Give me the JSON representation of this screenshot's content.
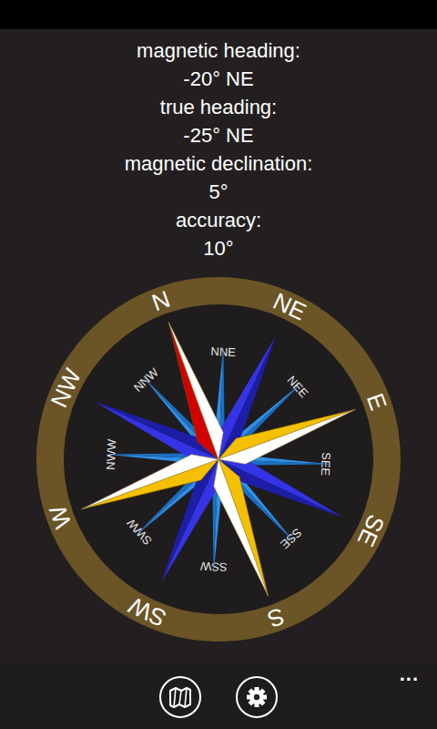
{
  "readouts": [
    {
      "label": "magnetic heading:",
      "value": "-20° NE"
    },
    {
      "label": "true heading:",
      "value": "-25° NE"
    },
    {
      "label": "magnetic declination:",
      "value": "5°"
    },
    {
      "label": "accuracy:",
      "value": "10°"
    }
  ],
  "compass": {
    "heading_degrees": -20,
    "cardinal_labels": [
      "N",
      "NE",
      "E",
      "SE",
      "S",
      "SW",
      "W",
      "NW"
    ],
    "minor_labels": [
      "NNE",
      "NEE",
      "SEE",
      "SSE",
      "SSW",
      "SWW",
      "NWW",
      "NNW"
    ]
  },
  "app_bar": {
    "more": "..."
  }
}
